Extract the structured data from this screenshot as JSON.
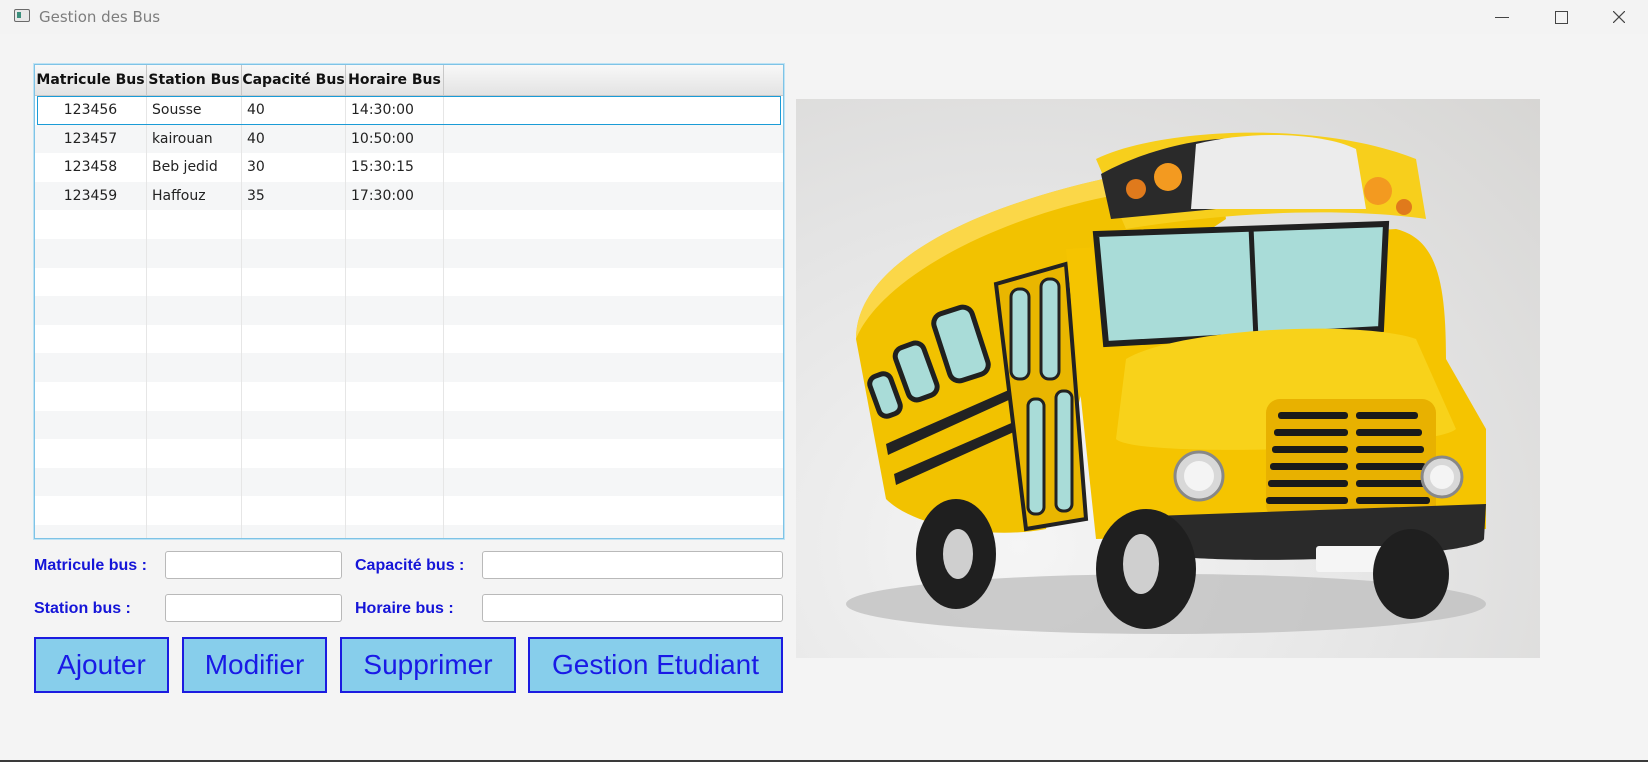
{
  "window": {
    "title": "Gestion des Bus"
  },
  "table": {
    "columns": [
      "Matricule Bus",
      "Station Bus",
      "Capacité Bus",
      "Horaire Bus"
    ],
    "rows": [
      [
        "123456",
        "Sousse",
        "40",
        "14:30:00"
      ],
      [
        "123457",
        "kairouan",
        "40",
        "10:50:00"
      ],
      [
        "123458",
        "Beb jedid",
        "30",
        "15:30:15"
      ],
      [
        "123459",
        "Haffouz",
        "35",
        "17:30:00"
      ]
    ],
    "selected_row": 0
  },
  "form": {
    "matricule_label": "Matricule bus :",
    "matricule_value": "",
    "capacite_label": "Capacité bus :",
    "capacite_value": "",
    "station_label": "Station bus :",
    "station_value": "",
    "horaire_label": "Horaire bus :",
    "horaire_value": ""
  },
  "buttons": {
    "ajouter": "Ajouter",
    "modifier": "Modifier",
    "supprimer": "Supprimer",
    "gestion_etudiant": "Gestion Etudiant"
  },
  "icons": {
    "app": "window-app-icon",
    "minimize": "minimize-icon",
    "maximize": "maximize-icon",
    "close": "close-icon",
    "image": "school-bus-illustration"
  },
  "colors": {
    "label_blue": "#1515d8",
    "button_fill": "#87ceeb",
    "button_border": "#1b1be0",
    "selection_border": "#1a9bd6",
    "bus_yellow": "#f6c700"
  }
}
